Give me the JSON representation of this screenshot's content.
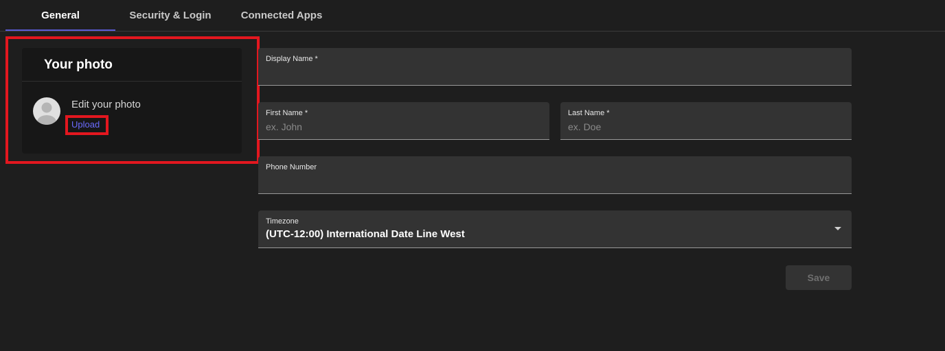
{
  "tabs": [
    {
      "label": "General",
      "active": true
    },
    {
      "label": "Security & Login",
      "active": false
    },
    {
      "label": "Connected Apps",
      "active": false
    }
  ],
  "photo_card": {
    "title": "Your photo",
    "edit_label": "Edit your photo",
    "upload_label": "Upload",
    "avatar_icon": "user-avatar-icon"
  },
  "form": {
    "display_name": {
      "label": "Display Name *",
      "value": "",
      "placeholder": ""
    },
    "first_name": {
      "label": "First Name *",
      "value": "",
      "placeholder": "ex. John"
    },
    "last_name": {
      "label": "Last Name *",
      "value": "",
      "placeholder": "ex. Doe"
    },
    "phone_number": {
      "label": "Phone Number",
      "value": "",
      "placeholder": ""
    },
    "timezone": {
      "label": "Timezone",
      "value": "(UTC-12:00) International Date Line West",
      "icon": "caret-down-icon"
    },
    "save_label": "Save"
  },
  "colors": {
    "accent": "#5b5bd6",
    "highlight": "#e3171f",
    "link": "#6b6bff",
    "background": "#1e1e1e"
  }
}
